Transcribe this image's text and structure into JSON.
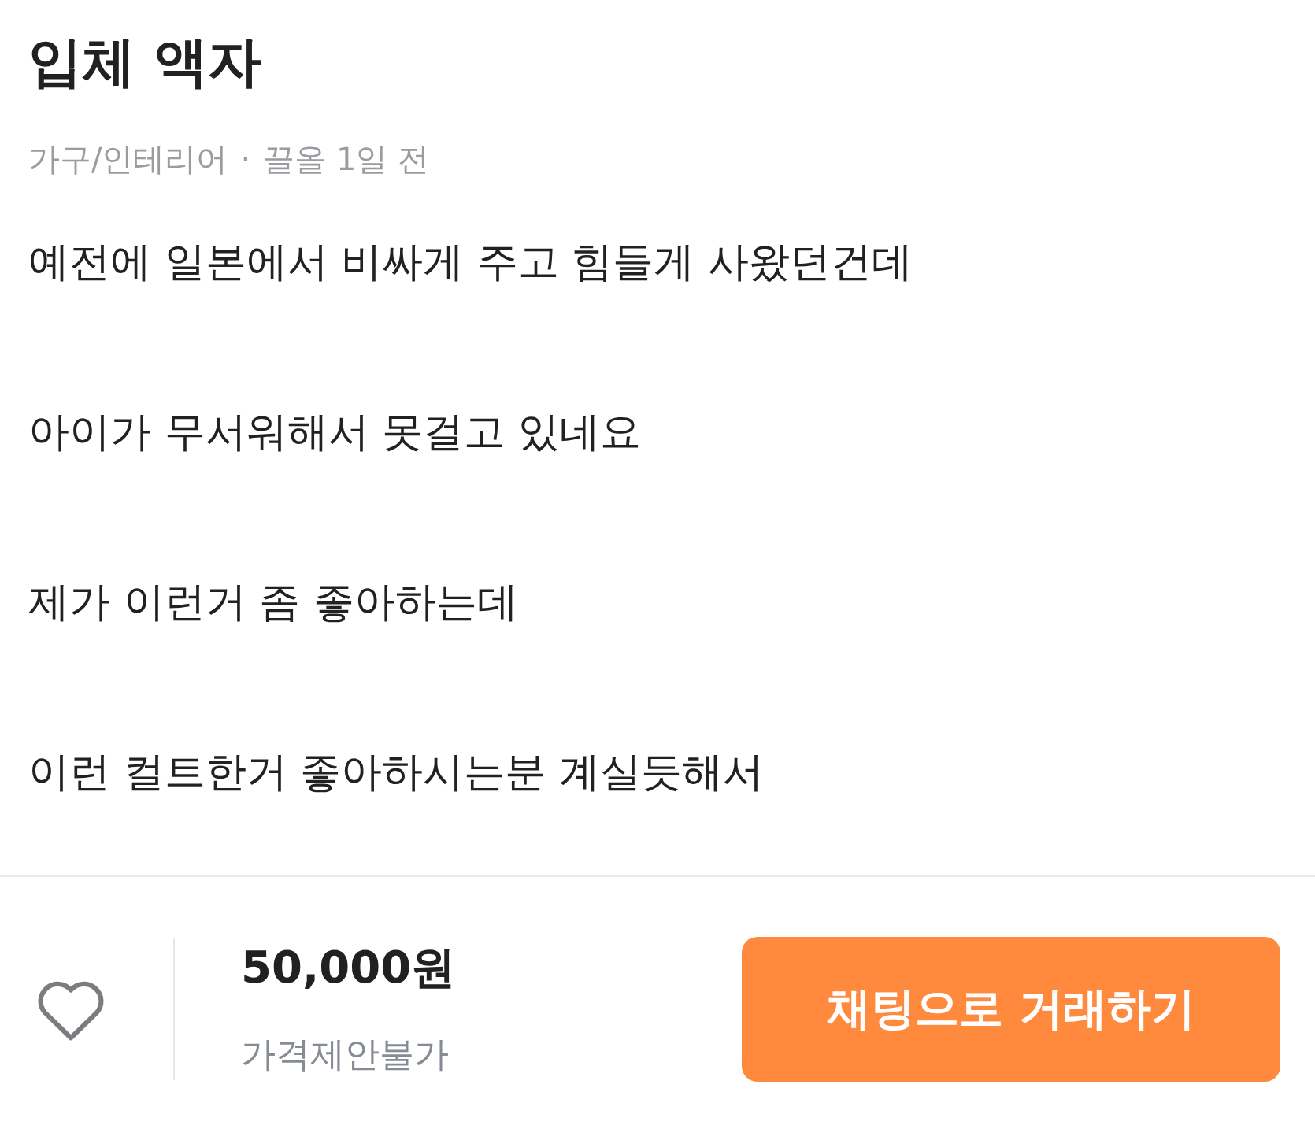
{
  "title": "입체 액자",
  "meta": {
    "category": "가구/인테리어",
    "separator": "·",
    "time": "끌올 1일 전"
  },
  "paragraphs": [
    "예전에 일본에서 비싸게 주고 힘들게 사왔던건데",
    "아이가 무서워해서 못걸고 있네요",
    "제가 이런거 좀 좋아하는데",
    "이런 컬트한거 좋아하시는분 계실듯해서"
  ],
  "bottom_bar": {
    "price": "50,000원",
    "negotiation": "가격제안불가",
    "button": "채팅으로 거래하기"
  }
}
